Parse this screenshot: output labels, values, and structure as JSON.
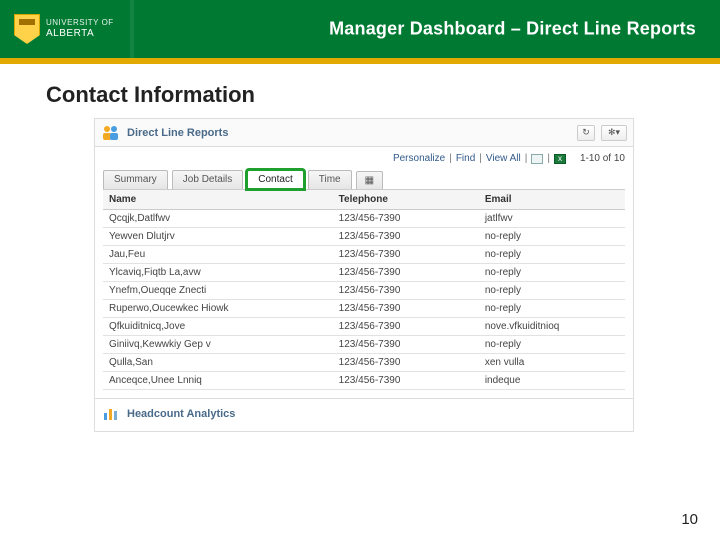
{
  "header": {
    "university_small": "UNIVERSITY OF",
    "university_name": "ALBERTA",
    "slide_title": "Manager Dashboard – Direct Line Reports"
  },
  "section_title": "Contact  Information",
  "panel": {
    "title": "Direct Line Reports",
    "refresh_icon": "↻",
    "menu_icon": "▾",
    "toolbar": {
      "personalize": "Personalize",
      "find": "Find",
      "view_all": "View All",
      "count": "1-10 of 10"
    },
    "tabs": [
      {
        "label": "Summary",
        "active": false
      },
      {
        "label": "Job Details",
        "active": false
      },
      {
        "label": "Contact",
        "active": true
      },
      {
        "label": "Time",
        "active": false
      }
    ],
    "columns": [
      "Name",
      "Telephone",
      "Email"
    ],
    "rows": [
      {
        "name": "Qcqjk,Datlfwv",
        "phone": "123/456-7390",
        "email": "jatlfwv"
      },
      {
        "name": "Yewven Dlutjrv",
        "phone": "123/456-7390",
        "email": "no-reply"
      },
      {
        "name": "Jau,Feu",
        "phone": "123/456-7390",
        "email": "no-reply"
      },
      {
        "name": "Ylcaviq,Fiqtb La,avw",
        "phone": "123/456-7390",
        "email": "no-reply"
      },
      {
        "name": "Ynefm,Oueqqe Znecti",
        "phone": "123/456-7390",
        "email": "no-reply"
      },
      {
        "name": "Ruperwo,Oucewkec Hiowk",
        "phone": "123/456-7390",
        "email": "no-reply"
      },
      {
        "name": "Qfkuiditnicq,Jove",
        "phone": "123/456-7390",
        "email": "nove.vfkuiditnioq"
      },
      {
        "name": "Giniivq,Kewwkiy Gep v",
        "phone": "123/456-7390",
        "email": "no-reply"
      },
      {
        "name": "Qulla,San",
        "phone": "123/456-7390",
        "email": "xen vulla"
      },
      {
        "name": "Anceqce,Unee Lnniq",
        "phone": "123/456-7390",
        "email": "indeque"
      }
    ],
    "sub_section": "Headcount Analytics"
  },
  "page_number": "10"
}
